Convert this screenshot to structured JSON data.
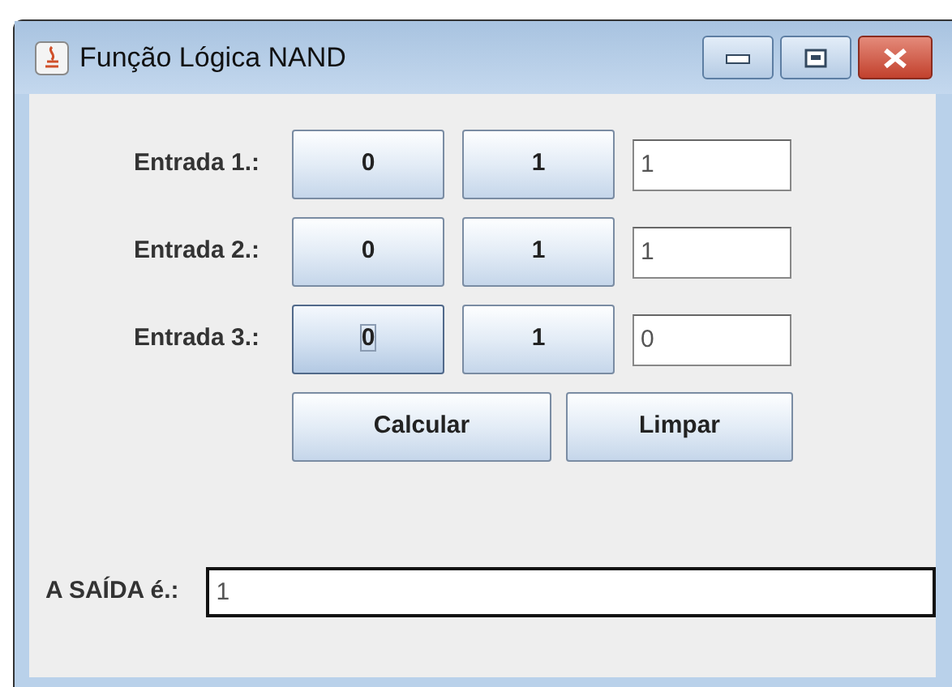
{
  "window": {
    "title": "Função Lógica NAND"
  },
  "inputs": [
    {
      "label": "Entrada 1.:",
      "buttons": [
        {
          "label": "0",
          "focused": false
        },
        {
          "label": "1",
          "focused": false
        }
      ],
      "value": "1"
    },
    {
      "label": "Entrada 2.:",
      "buttons": [
        {
          "label": "0",
          "focused": false
        },
        {
          "label": "1",
          "focused": false
        }
      ],
      "value": "1"
    },
    {
      "label": "Entrada 3.:",
      "buttons": [
        {
          "label": "0",
          "focused": true
        },
        {
          "label": "1",
          "focused": false
        }
      ],
      "value": "0"
    }
  ],
  "actions": [
    "Calcular",
    "Limpar"
  ],
  "output": {
    "label": "A SAÍDA é.:",
    "value": "1"
  }
}
